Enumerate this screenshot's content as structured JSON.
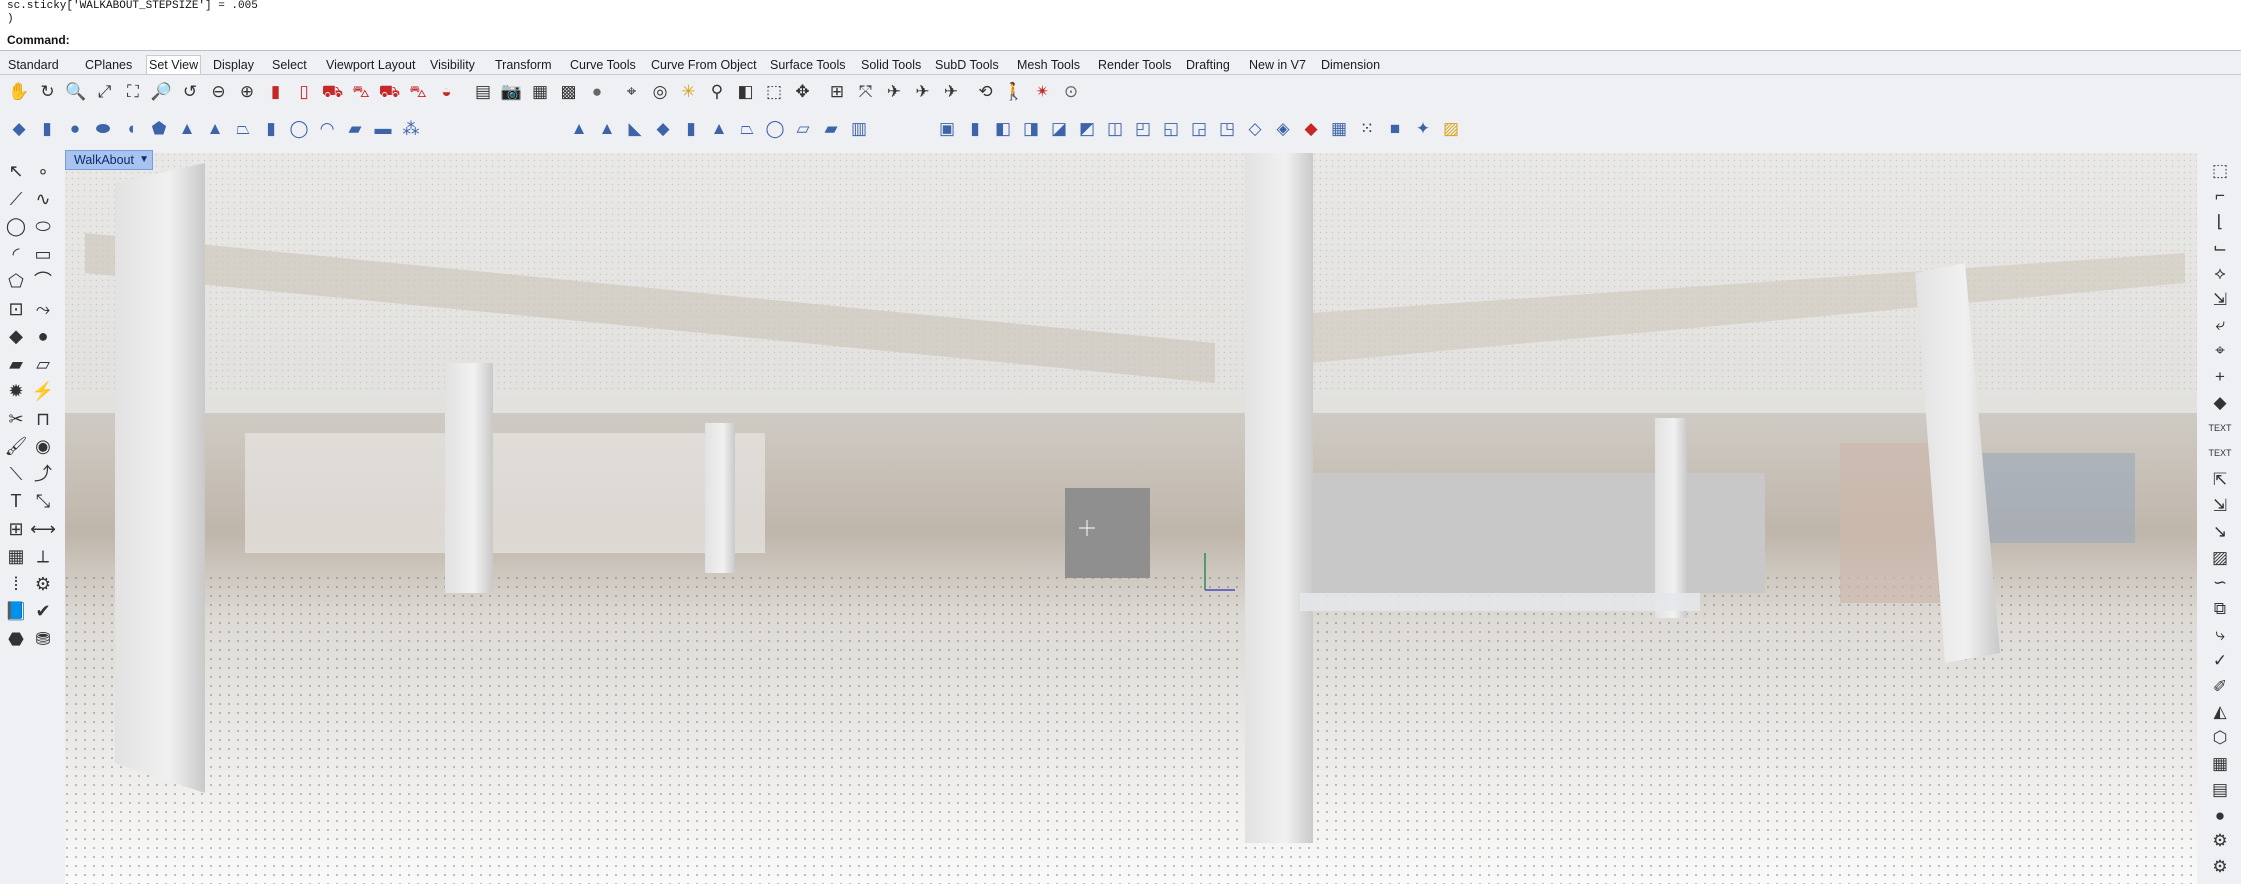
{
  "command_history": [
    "sc.sticky['WALKABOUT_STEPSIZE'] = .005",
    ")"
  ],
  "command_prompt": {
    "label": "Command:",
    "value": ""
  },
  "tabs": [
    "Standard",
    "CPlanes",
    "Set View",
    "Display",
    "Select",
    "Viewport Layout",
    "Visibility",
    "Transform",
    "Curve Tools",
    "Curve From Object",
    "Surface Tools",
    "Solid Tools",
    "SubD Tools",
    "Mesh Tools",
    "Render Tools",
    "Drafting",
    "New in V7",
    "Dimension"
  ],
  "active_tab": "Set View",
  "toolbar_row1": [
    {
      "name": "pan-icon",
      "glyph": "✋",
      "tone": "n"
    },
    {
      "name": "rotate-view-icon",
      "glyph": "↻",
      "tone": "n"
    },
    {
      "name": "zoom-icon",
      "glyph": "🔍",
      "tone": "n"
    },
    {
      "name": "zoom-extents-icon",
      "glyph": "⤢",
      "tone": "n"
    },
    {
      "name": "zoom-window-icon",
      "glyph": "⛶",
      "tone": "n"
    },
    {
      "name": "zoom-selected-icon",
      "glyph": "🔎",
      "tone": "n"
    },
    {
      "name": "undo-view-icon",
      "glyph": "↺",
      "tone": "n"
    },
    {
      "name": "zoom-out-icon",
      "glyph": "⊖",
      "tone": "n"
    },
    {
      "name": "zoom-target-icon",
      "glyph": "⊕",
      "tone": "n"
    },
    {
      "name": "light-icon",
      "glyph": "▮",
      "tone": "r"
    },
    {
      "name": "lamp-icon",
      "glyph": "▯",
      "tone": "r"
    },
    {
      "name": "car-icon",
      "glyph": "⛟",
      "tone": "r"
    },
    {
      "name": "car-side-icon",
      "glyph": "⛍",
      "tone": "r"
    },
    {
      "name": "car-front-icon",
      "glyph": "⛟",
      "tone": "r"
    },
    {
      "name": "car-back-icon",
      "glyph": "⛍",
      "tone": "r"
    },
    {
      "name": "sport-car-icon",
      "glyph": "◒",
      "tone": "r"
    },
    {
      "name": "named-view-icon",
      "glyph": "▤",
      "tone": "n"
    },
    {
      "name": "camera-icon",
      "glyph": "📷",
      "tone": "n"
    },
    {
      "name": "restore-view-icon",
      "glyph": "▦",
      "tone": "n"
    },
    {
      "name": "named-views-icon",
      "glyph": "▩",
      "tone": "n"
    },
    {
      "name": "sphere-icon",
      "glyph": "●",
      "tone": "g"
    },
    {
      "name": "place-camera-icon",
      "glyph": "⌖",
      "tone": "n"
    },
    {
      "name": "target-icon",
      "glyph": "◎",
      "tone": "n"
    },
    {
      "name": "set-target-icon",
      "glyph": "✳",
      "tone": "y"
    },
    {
      "name": "tripod-icon",
      "glyph": "⚲",
      "tone": "n"
    },
    {
      "name": "clipping-plane-icon",
      "glyph": "◧",
      "tone": "n"
    },
    {
      "name": "perspective-box-icon",
      "glyph": "⬚",
      "tone": "n"
    },
    {
      "name": "orbit-icon",
      "glyph": "✥",
      "tone": "n"
    },
    {
      "name": "match-view-icon",
      "glyph": "⊞",
      "tone": "n"
    },
    {
      "name": "rotate-icon",
      "glyph": "⤧",
      "tone": "n"
    },
    {
      "name": "plane-fly-icon",
      "glyph": "✈",
      "tone": "n"
    },
    {
      "name": "fly-icon",
      "glyph": "✈",
      "tone": "n"
    },
    {
      "name": "plane-icon",
      "glyph": "✈",
      "tone": "n"
    },
    {
      "name": "rotate-around-icon",
      "glyph": "⟲",
      "tone": "n"
    },
    {
      "name": "walk-icon",
      "glyph": "🚶",
      "tone": "n"
    },
    {
      "name": "sun-icon",
      "glyph": "✴",
      "tone": "r"
    },
    {
      "name": "compass-icon",
      "glyph": "⊙",
      "tone": "g"
    }
  ],
  "toolbar_row2": [
    {
      "name": "box-icon",
      "glyph": "◆",
      "tone": "b"
    },
    {
      "name": "cylinder-icon",
      "glyph": "▮",
      "tone": "b"
    },
    {
      "name": "sphere-icon",
      "glyph": "●",
      "tone": "b"
    },
    {
      "name": "ellipsoid-icon",
      "glyph": "⬬",
      "tone": "b"
    },
    {
      "name": "paraboloid-icon",
      "glyph": "◖",
      "tone": "b"
    },
    {
      "name": "shield-icon",
      "glyph": "⬟",
      "tone": "b"
    },
    {
      "name": "cone-icon",
      "glyph": "▲",
      "tone": "b"
    },
    {
      "name": "pyramid-icon",
      "glyph": "▲",
      "tone": "b"
    },
    {
      "name": "truncated-cone-icon",
      "glyph": "⏢",
      "tone": "b"
    },
    {
      "name": "tube-icon",
      "glyph": "▮",
      "tone": "b"
    },
    {
      "name": "torus-icon",
      "glyph": "◯",
      "tone": "b"
    },
    {
      "name": "pipe-icon",
      "glyph": "◠",
      "tone": "b"
    },
    {
      "name": "extrude-icon",
      "glyph": "▰",
      "tone": "b"
    },
    {
      "name": "slab-icon",
      "glyph": "▬",
      "tone": "b"
    },
    {
      "name": "cage-icon",
      "glyph": "⁂",
      "tone": "b"
    },
    {
      "name": "tetrahedron-icon",
      "glyph": "▲",
      "tone": "b"
    },
    {
      "name": "cone-surface-icon",
      "glyph": "▲",
      "tone": "b"
    },
    {
      "name": "wedge-icon",
      "glyph": "◣",
      "tone": "b"
    },
    {
      "name": "mesh-box-icon",
      "glyph": "◆",
      "tone": "b"
    },
    {
      "name": "mesh-cylinder-icon",
      "glyph": "▮",
      "tone": "b"
    },
    {
      "name": "mesh-cone-icon",
      "glyph": "▲",
      "tone": "b"
    },
    {
      "name": "mesh-frustum-icon",
      "glyph": "⏢",
      "tone": "b"
    },
    {
      "name": "mesh-torus-icon",
      "glyph": "◯",
      "tone": "b"
    },
    {
      "name": "mesh-plane-icon",
      "glyph": "▱",
      "tone": "b"
    },
    {
      "name": "mesh-patch-icon",
      "glyph": "▰",
      "tone": "b"
    },
    {
      "name": "mesh-drape-icon",
      "glyph": "▥",
      "tone": "b"
    },
    {
      "name": "solid-box-icon",
      "glyph": "▣",
      "tone": "b"
    },
    {
      "name": "solid-cyl-icon",
      "glyph": "▮",
      "tone": "b"
    },
    {
      "name": "boolean-union-icon",
      "glyph": "◧",
      "tone": "b"
    },
    {
      "name": "boolean-diff-icon",
      "glyph": "◨",
      "tone": "b"
    },
    {
      "name": "solid-edit-icon",
      "glyph": "◪",
      "tone": "b"
    },
    {
      "name": "fillet-edge-icon",
      "glyph": "◩",
      "tone": "b"
    },
    {
      "name": "chamfer-icon",
      "glyph": "◫",
      "tone": "b"
    },
    {
      "name": "shell-icon",
      "glyph": "◰",
      "tone": "b"
    },
    {
      "name": "cap-icon",
      "glyph": "◱",
      "tone": "b"
    },
    {
      "name": "extract-icon",
      "glyph": "◲",
      "tone": "b"
    },
    {
      "name": "cut-icon",
      "glyph": "◳",
      "tone": "b"
    },
    {
      "name": "split-icon",
      "glyph": "◇",
      "tone": "b"
    },
    {
      "name": "wire-cut-icon",
      "glyph": "◈",
      "tone": "b"
    },
    {
      "name": "pattern-icon",
      "glyph": "◆",
      "tone": "r"
    },
    {
      "name": "grid-icon",
      "glyph": "▦",
      "tone": "b"
    },
    {
      "name": "points-icon",
      "glyph": "⁙",
      "tone": "n"
    },
    {
      "name": "cube-small-icon",
      "glyph": "■",
      "tone": "b"
    },
    {
      "name": "move-face-icon",
      "glyph": "✦",
      "tone": "b"
    },
    {
      "name": "box-edit-icon",
      "glyph": "▨",
      "tone": "y"
    }
  ],
  "viewport_label": "WalkAbout",
  "left_tools": [
    {
      "name": "select-arrow-icon",
      "glyph": "↖"
    },
    {
      "name": "point-icon",
      "glyph": "∘"
    },
    {
      "name": "polyline-icon",
      "glyph": "⟋"
    },
    {
      "name": "curve-icon",
      "glyph": "∿"
    },
    {
      "name": "circle-icon",
      "glyph": "◯"
    },
    {
      "name": "ellipse-icon",
      "glyph": "⬭"
    },
    {
      "name": "arc-icon",
      "glyph": "◜"
    },
    {
      "name": "rectangle-icon",
      "glyph": "▭"
    },
    {
      "name": "polygon-icon",
      "glyph": "⬠"
    },
    {
      "name": "fillet-icon",
      "glyph": "⌒"
    },
    {
      "name": "offset-icon",
      "glyph": "⊡"
    },
    {
      "name": "extend-icon",
      "glyph": "⤳"
    },
    {
      "name": "solid-box-icon",
      "glyph": "◆"
    },
    {
      "name": "solid-sphere-icon",
      "glyph": "●"
    },
    {
      "name": "surface-icon",
      "glyph": "▰"
    },
    {
      "name": "loft-icon",
      "glyph": "▱"
    },
    {
      "name": "explode-icon",
      "glyph": "✹"
    },
    {
      "name": "drape-icon",
      "glyph": "⚡"
    },
    {
      "name": "trim-icon",
      "glyph": "✂"
    },
    {
      "name": "join-icon",
      "glyph": "⊓"
    },
    {
      "name": "paint-icon",
      "glyph": "🖌"
    },
    {
      "name": "material-icon",
      "glyph": "◉"
    },
    {
      "name": "line-icon",
      "glyph": "⟍"
    },
    {
      "name": "curve-edit-icon",
      "glyph": "⤴"
    },
    {
      "name": "text-icon",
      "glyph": "T"
    },
    {
      "name": "scale-icon",
      "glyph": "⤡"
    },
    {
      "name": "layout-icon",
      "glyph": "⊞"
    },
    {
      "name": "dimension-icon",
      "glyph": "⟷"
    },
    {
      "name": "mesh-icon",
      "glyph": "▦"
    },
    {
      "name": "measure-icon",
      "glyph": "⟂"
    },
    {
      "name": "array-icon",
      "glyph": "⁞"
    },
    {
      "name": "analyze-icon",
      "glyph": "⚙"
    },
    {
      "name": "book-icon",
      "glyph": "📘"
    },
    {
      "name": "check-icon",
      "glyph": "✔"
    },
    {
      "name": "render-icon",
      "glyph": "⬣"
    },
    {
      "name": "paint-bucket-icon",
      "glyph": "⛃"
    }
  ],
  "right_tools": [
    {
      "name": "mesh-face-icon",
      "glyph": "⬚"
    },
    {
      "name": "mesh-edge-icon",
      "glyph": "⌐"
    },
    {
      "name": "corner-icon",
      "glyph": "⌊"
    },
    {
      "name": "polyline-step-icon",
      "glyph": "⌙"
    },
    {
      "name": "node-icon",
      "glyph": "⟡"
    },
    {
      "name": "pick-icon",
      "glyph": "⇲"
    },
    {
      "name": "step-icon",
      "glyph": "⤶"
    },
    {
      "name": "vertex-icon",
      "glyph": "⌖"
    },
    {
      "name": "plus-icon",
      "glyph": "+"
    },
    {
      "name": "solid-tool-icon",
      "glyph": "◆"
    },
    {
      "name": "text-object-icon",
      "glyph": "TEXT"
    },
    {
      "name": "text-edit-icon",
      "glyph": "TEXT"
    },
    {
      "name": "dim-icon",
      "glyph": "⇱"
    },
    {
      "name": "dim2-icon",
      "glyph": "⇲"
    },
    {
      "name": "leader-icon",
      "glyph": "↘"
    },
    {
      "name": "hatch-icon",
      "glyph": "▨"
    },
    {
      "name": "sketch-icon",
      "glyph": "∽"
    },
    {
      "name": "layer-icon",
      "glyph": "⧉"
    },
    {
      "name": "surface-edge-icon",
      "glyph": "⤷"
    },
    {
      "name": "check-tool-icon",
      "glyph": "✓"
    },
    {
      "name": "edit-icon",
      "glyph": "✐"
    },
    {
      "name": "render-mat-icon",
      "glyph": "◭"
    },
    {
      "name": "cube-icon",
      "glyph": "⬡"
    },
    {
      "name": "grid-tool-icon",
      "glyph": "▦"
    },
    {
      "name": "folder-icon",
      "glyph": "▤"
    },
    {
      "name": "sphere-icon",
      "glyph": "●"
    },
    {
      "name": "gear-icon",
      "glyph": "⚙"
    },
    {
      "name": "settings-icon",
      "glyph": "⚙"
    }
  ]
}
